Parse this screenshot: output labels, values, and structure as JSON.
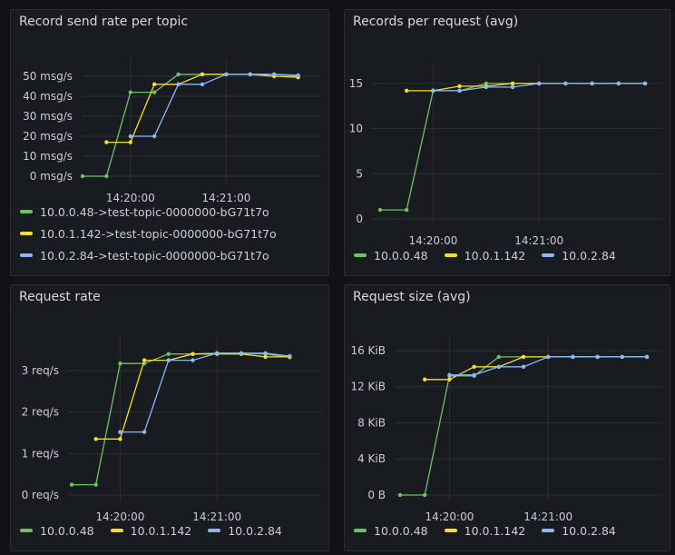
{
  "colors": {
    "green": "#73bf69",
    "yellow": "#fade2a",
    "blue": "#8ab8ff",
    "grid": "#2c2f35"
  },
  "panels": [
    {
      "id": "send-rate",
      "title": "Record send rate per topic",
      "legend_layout": "list",
      "legend": [
        "10.0.0.48->test-topic-0000000-bG71t7o",
        "10.0.1.142->test-topic-0000000-bG71t7o",
        "10.0.2.84->test-topic-0000000-bG71t7o"
      ]
    },
    {
      "id": "records-per-request",
      "title": "Records per request (avg)",
      "legend_layout": "inline",
      "legend": [
        "10.0.0.48",
        "10.0.1.142",
        "10.0.2.84"
      ]
    },
    {
      "id": "request-rate",
      "title": "Request rate",
      "legend_layout": "inline",
      "legend": [
        "10.0.0.48",
        "10.0.1.142",
        "10.0.2.84"
      ]
    },
    {
      "id": "request-size",
      "title": "Request size (avg)",
      "legend_layout": "inline",
      "legend": [
        "10.0.0.48",
        "10.0.1.142",
        "10.0.2.84"
      ]
    }
  ],
  "chart_data": [
    {
      "type": "line",
      "title": "Record send rate per topic",
      "xlabel": "",
      "ylabel": "",
      "x": [
        "14:19:30",
        "14:19:45",
        "14:20:00",
        "14:20:15",
        "14:20:30",
        "14:20:45",
        "14:21:00",
        "14:21:15",
        "14:21:30",
        "14:21:45"
      ],
      "xticks": [
        "14:20:00",
        "14:21:00"
      ],
      "yticks": [
        "0 msg/s",
        "10 msg/s",
        "20 msg/s",
        "30 msg/s",
        "40 msg/s",
        "50 msg/s"
      ],
      "ylim": [
        0,
        55
      ],
      "series": [
        {
          "name": "10.0.0.48->test-topic-0000000-bG71t7o",
          "color": "green",
          "values": [
            0,
            0,
            42,
            42,
            51,
            51,
            51,
            51,
            51,
            50
          ]
        },
        {
          "name": "10.0.1.142->test-topic-0000000-bG71t7o",
          "color": "yellow",
          "values": [
            null,
            17,
            17,
            46,
            46,
            51,
            51,
            51,
            50,
            49.5
          ]
        },
        {
          "name": "10.0.2.84->test-topic-0000000-bG71t7o",
          "color": "blue",
          "values": [
            null,
            null,
            20,
            20,
            46,
            46,
            51,
            51,
            51,
            50.5
          ]
        }
      ]
    },
    {
      "type": "line",
      "title": "Records per request (avg)",
      "xlabel": "",
      "ylabel": "",
      "x": [
        "14:19:30",
        "14:19:45",
        "14:20:00",
        "14:20:15",
        "14:20:30",
        "14:20:45",
        "14:21:00",
        "14:21:15",
        "14:21:30",
        "14:21:45",
        "14:22:00"
      ],
      "xticks": [
        "14:20:00",
        "14:21:00"
      ],
      "yticks": [
        "0",
        "5",
        "10",
        "15"
      ],
      "ylim": [
        0,
        16.5
      ],
      "series": [
        {
          "name": "10.0.0.48",
          "color": "green",
          "values": [
            1,
            1,
            14.2,
            14.2,
            15,
            15,
            15,
            15,
            15,
            15,
            15
          ]
        },
        {
          "name": "10.0.1.142",
          "color": "yellow",
          "values": [
            null,
            14.2,
            14.2,
            14.7,
            14.7,
            15,
            15,
            15,
            15,
            15,
            15
          ]
        },
        {
          "name": "10.0.2.84",
          "color": "blue",
          "values": [
            null,
            null,
            14.2,
            14.2,
            14.6,
            14.6,
            15,
            15,
            15,
            15,
            15
          ]
        }
      ]
    },
    {
      "type": "line",
      "title": "Request rate",
      "xlabel": "",
      "ylabel": "",
      "x": [
        "14:19:30",
        "14:19:45",
        "14:20:00",
        "14:20:15",
        "14:20:30",
        "14:20:45",
        "14:21:00",
        "14:21:15",
        "14:21:30",
        "14:21:45"
      ],
      "xticks": [
        "14:20:00",
        "14:21:00"
      ],
      "yticks": [
        "0 req/s",
        "1 req/s",
        "2 req/s",
        "3 req/s"
      ],
      "ylim": [
        0,
        3.7
      ],
      "series": [
        {
          "name": "10.0.0.48",
          "color": "green",
          "values": [
            0.25,
            0.25,
            3.17,
            3.17,
            3.4,
            3.4,
            3.42,
            3.42,
            3.4,
            3.32
          ]
        },
        {
          "name": "10.0.1.142",
          "color": "yellow",
          "values": [
            null,
            1.35,
            1.35,
            3.25,
            3.25,
            3.4,
            3.4,
            3.4,
            3.33,
            3.33
          ]
        },
        {
          "name": "10.0.2.84",
          "color": "blue",
          "values": [
            null,
            null,
            1.52,
            1.52,
            3.25,
            3.25,
            3.42,
            3.42,
            3.42,
            3.35
          ]
        }
      ]
    },
    {
      "type": "line",
      "title": "Request size (avg)",
      "xlabel": "",
      "ylabel": "",
      "x": [
        "14:19:30",
        "14:19:45",
        "14:20:00",
        "14:20:15",
        "14:20:30",
        "14:20:45",
        "14:21:00",
        "14:21:15",
        "14:21:30",
        "14:21:45",
        "14:22:00"
      ],
      "xticks": [
        "14:20:00",
        "14:21:00"
      ],
      "yticks": [
        "0 B",
        "4 KiB",
        "8 KiB",
        "12 KiB",
        "16 KiB"
      ],
      "ylim": [
        0,
        17
      ],
      "series": [
        {
          "name": "10.0.0.48",
          "color": "green",
          "values": [
            0,
            0,
            13.2,
            13.2,
            15.3,
            15.3,
            15.3,
            15.3,
            15.3,
            15.3,
            15.3
          ]
        },
        {
          "name": "10.0.1.142",
          "color": "yellow",
          "values": [
            null,
            12.8,
            12.8,
            14.2,
            14.2,
            15.3,
            15.3,
            15.3,
            15.3,
            15.3,
            15.3
          ]
        },
        {
          "name": "10.0.2.84",
          "color": "blue",
          "values": [
            null,
            null,
            13.3,
            13.3,
            14.2,
            14.2,
            15.3,
            15.3,
            15.3,
            15.3,
            15.3
          ]
        }
      ]
    }
  ]
}
